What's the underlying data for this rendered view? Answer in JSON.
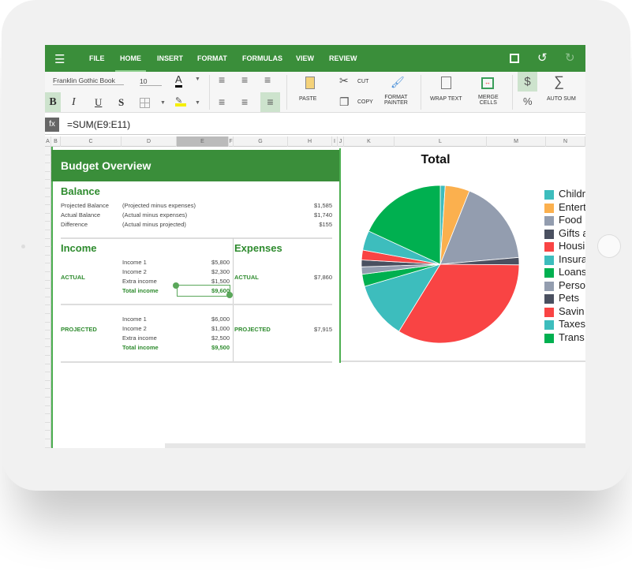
{
  "toolbar": {
    "tabs": [
      "FILE",
      "HOME",
      "INSERT",
      "FORMAT",
      "FORMULAS",
      "VIEW",
      "REVIEW"
    ],
    "active_tab": "HOME",
    "icons": [
      "menu-icon",
      "save-icon",
      "undo-icon",
      "redo-icon"
    ]
  },
  "ribbon": {
    "font_name": "Franklin Gothic Book",
    "font_size": "10",
    "bold": "B",
    "italic": "I",
    "underline": "U",
    "strike": "S",
    "font_color_glyph": "A",
    "paste": "PASTE",
    "cut": "CUT",
    "copy": "COPY",
    "format_painter_1": "FORMAT",
    "format_painter_2": "PAINTER",
    "wrap_text": "WRAP TEXT",
    "merge_1": "MERGE",
    "merge_2": "CELLS",
    "currency": "$",
    "percent": "%",
    "sigma": "∑",
    "auto_sum": "AUTO SUM"
  },
  "formula_bar": {
    "fx": "fx",
    "value": "=SUM(E9:E11)"
  },
  "columns": [
    "A",
    "B",
    "C",
    "D",
    "E",
    "F",
    "G",
    "H",
    "I",
    "J",
    "K",
    "L",
    "M",
    "N"
  ],
  "selected_column": "E",
  "sheet": {
    "title": "Budget Overview",
    "balance": {
      "heading": "Balance",
      "rows": [
        {
          "label": "Projected Balance",
          "desc": "(Projected  minus expenses)",
          "value": "$1,585"
        },
        {
          "label": "Actual Balance",
          "desc": "(Actual  minus expenses)",
          "value": "$1,740"
        },
        {
          "label": "Difference",
          "desc": "(Actual minus projected)",
          "value": "$155"
        }
      ]
    },
    "income": {
      "heading": "Income",
      "actual": {
        "label": "ACTUAL",
        "items": [
          {
            "name": "Income 1",
            "value": "$5,800"
          },
          {
            "name": "Income 2",
            "value": "$2,300"
          },
          {
            "name": "Extra income",
            "value": "$1,500"
          }
        ],
        "total_label": "Total income",
        "total": "$9,600"
      },
      "projected": {
        "label": "PROJECTED",
        "items": [
          {
            "name": "Income 1",
            "value": "$6,000"
          },
          {
            "name": "Income 2",
            "value": "$1,000"
          },
          {
            "name": "Extra income",
            "value": "$2,500"
          }
        ],
        "total_label": "Total income",
        "total": "$9,500"
      }
    },
    "expenses": {
      "heading": "Expenses",
      "actual_label": "ACTUAL",
      "actual": "$7,860",
      "projected_label": "PROJECTED",
      "projected": "$7,915"
    }
  },
  "chart_data": {
    "type": "pie",
    "title": "Total",
    "legend_placement": "right",
    "labels": [
      "Childr",
      "Entert",
      "Food",
      "Gifts a",
      "Housi",
      "Insura",
      "Loans",
      "Perso",
      "Pets",
      "Savin",
      "Taxes",
      "Trans"
    ],
    "values": [
      1,
      5,
      17.5,
      1.5,
      33.5,
      11.6,
      2.5,
      1.5,
      1.4,
      2,
      4,
      18
    ],
    "colors": [
      "#3dbdbd",
      "#fbb04e",
      "#939daf",
      "#4a5060",
      "#f94444",
      "#3dbdbd",
      "#00b050",
      "#939daf",
      "#4a5060",
      "#f94444",
      "#3dbdbd",
      "#00b050"
    ]
  },
  "colors": {
    "brand": "#3a8e3a",
    "accent_text": "#2e8b2e"
  }
}
